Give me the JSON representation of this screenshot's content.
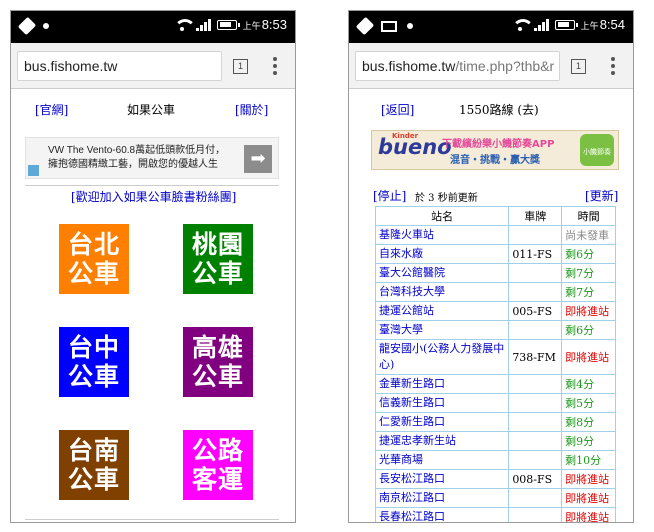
{
  "left_phone": {
    "status": {
      "ampm": "上午",
      "time": "8:53"
    },
    "url": {
      "host": "bus.fishome.tw",
      "path": ""
    },
    "tab_count": "1",
    "nav": {
      "official": "[官網]",
      "title": "如果公車",
      "about": "[關於]"
    },
    "ad": {
      "line1": "VW The Vento-60.8萬起低頭款低月付，",
      "line2": "擁抱德國精緻工藝，開啟您的優越人生",
      "arrow": "➡"
    },
    "fan_link": "[歡迎加入如果公車臉書粉絲團]",
    "cities": [
      {
        "line1": "台北",
        "line2": "公車",
        "color": "#ff8000"
      },
      {
        "line1": "桃園",
        "line2": "公車",
        "color": "#008000"
      },
      {
        "line1": "台中",
        "line2": "公車",
        "color": "#0000ff"
      },
      {
        "line1": "高雄",
        "line2": "公車",
        "color": "#800080"
      },
      {
        "line1": "台南",
        "line2": "公車",
        "color": "#804000"
      },
      {
        "line1": "公路",
        "line2": "客運",
        "color": "#ff00ff"
      }
    ]
  },
  "right_phone": {
    "status": {
      "ampm": "上午",
      "time": "8:54"
    },
    "url": {
      "host": "bus.fishome.tw",
      "path": "/time.php?thb&r"
    },
    "tab_count": "1",
    "nav": {
      "back": "[返回]",
      "route_title": "1550路線 (去)"
    },
    "banner": {
      "brand": "bueno",
      "kinder": "Kinder",
      "line1": "下載繽紛樂小饑節奏APP",
      "line2": "混音・挑戰・贏大獎",
      "badge": "小饑節奏"
    },
    "toolbar": {
      "stop": "[停止]",
      "updated": "於 3 秒前更新",
      "refresh": "[更新]"
    },
    "table_headers": {
      "stop": "站名",
      "plate": "車牌",
      "time": "時間"
    },
    "rows": [
      {
        "stop": "基隆火車站",
        "plate": "",
        "time": "尚未發車",
        "status": "grey"
      },
      {
        "stop": "自來水廠",
        "plate": "011-FS",
        "time": "剩6分",
        "status": "green"
      },
      {
        "stop": "臺大公館醫院",
        "plate": "",
        "time": "剩7分",
        "status": "green"
      },
      {
        "stop": "台灣科技大學",
        "plate": "",
        "time": "剩7分",
        "status": "green"
      },
      {
        "stop": "捷運公館站",
        "plate": "005-FS",
        "time": "即將進站",
        "status": "red"
      },
      {
        "stop": "臺灣大學",
        "plate": "",
        "time": "剩6分",
        "status": "green"
      },
      {
        "stop": "龍安國小(公務人力發展中心)",
        "plate": "738-FM",
        "time": "即將進站",
        "status": "red"
      },
      {
        "stop": "金華新生路口",
        "plate": "",
        "time": "剩4分",
        "status": "green"
      },
      {
        "stop": "信義新生路口",
        "plate": "",
        "time": "剩5分",
        "status": "green"
      },
      {
        "stop": "仁愛新生路口",
        "plate": "",
        "time": "剩8分",
        "status": "green"
      },
      {
        "stop": "捷運忠孝新生站",
        "plate": "",
        "time": "剩9分",
        "status": "green"
      },
      {
        "stop": "光華商場",
        "plate": "",
        "time": "剩10分",
        "status": "green"
      },
      {
        "stop": "長安松江路口",
        "plate": "008-FS",
        "time": "即將進站",
        "status": "red"
      },
      {
        "stop": "南京松江路口",
        "plate": "",
        "time": "即將進站",
        "status": "red"
      },
      {
        "stop": "長春松江路口",
        "plate": "",
        "time": "即將進站",
        "status": "red"
      }
    ],
    "status_colors": {
      "green": "#1a9a1a",
      "red": "#e00000",
      "grey": "#888888"
    }
  }
}
